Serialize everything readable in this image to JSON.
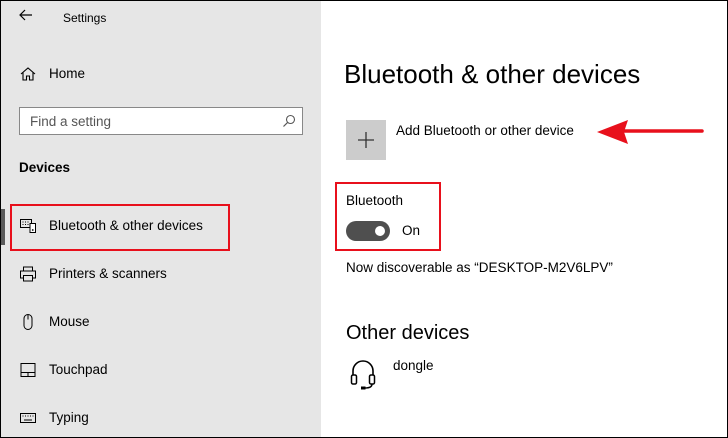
{
  "window": {
    "title": "Settings"
  },
  "sidebar": {
    "home_label": "Home",
    "search": {
      "placeholder": "Find a setting"
    },
    "section_title": "Devices",
    "items": [
      {
        "label": "Bluetooth & other devices",
        "icon": "bluetooth-devices-icon",
        "selected": true
      },
      {
        "label": "Printers & scanners",
        "icon": "printer-icon"
      },
      {
        "label": "Mouse",
        "icon": "mouse-icon"
      },
      {
        "label": "Touchpad",
        "icon": "touchpad-icon"
      },
      {
        "label": "Typing",
        "icon": "keyboard-icon"
      }
    ]
  },
  "main": {
    "title": "Bluetooth & other devices",
    "add_device_label": "Add Bluetooth or other device",
    "bluetooth": {
      "label": "Bluetooth",
      "toggle_state": "On",
      "enabled": true
    },
    "discoverable_text": "Now discoverable as “DESKTOP-M2V6LPV”",
    "other_devices": {
      "title": "Other devices",
      "devices": [
        {
          "name": "dongle",
          "icon": "headset-icon"
        }
      ]
    }
  },
  "annotations": {
    "highlight_color": "#e8101c"
  },
  "colors": {
    "sidebar_bg": "#e6e6e6",
    "toggle_on": "#4f4f4f",
    "add_tile_bg": "#cccccc"
  }
}
